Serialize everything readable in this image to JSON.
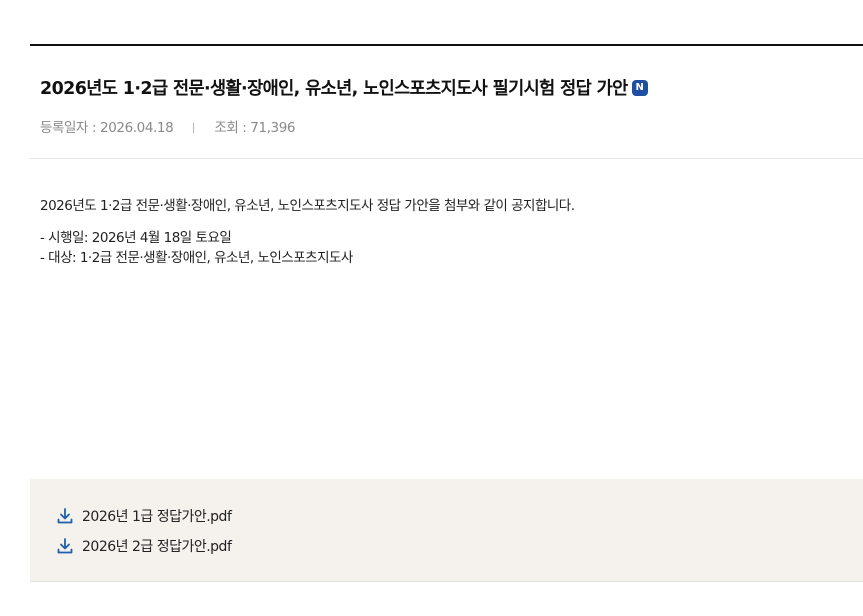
{
  "article": {
    "title": "2026년도 1·2급 전문·생활·장애인, 유소년, 노인스포츠지도사 필기시험 정답 가안",
    "new_badge": "N",
    "meta": {
      "date_label": "등록일자 : 2026.04.18",
      "views_label": "조회 : 71,396"
    },
    "body": {
      "intro": "2026년도 1·2급 전문·생활·장애인, 유소년, 노인스포츠지도사 정답 가안을 첨부와 같이 공지합니다.",
      "line1": "- 시행일: 2026년 4월 18일 토요일",
      "line2": "- 대상: 1·2급 전문·생활·장애인, 유소년, 노인스포츠지도사"
    }
  },
  "attachments": [
    {
      "name": "2026년 1급 정답가안.pdf",
      "icon": "download-icon"
    },
    {
      "name": "2026년 2급 정답가안.pdf",
      "icon": "download-icon"
    }
  ],
  "colors": {
    "accent_badge": "#1f4fa3",
    "download_icon": "#1f5fa8",
    "attachment_bg": "#f5f2ee"
  }
}
